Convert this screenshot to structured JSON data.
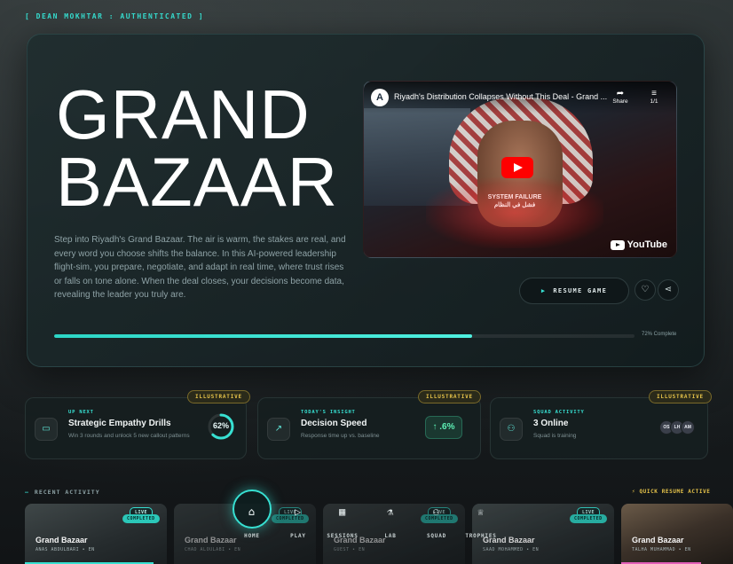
{
  "status": {
    "text": "[ DEAN MOKHTAR : AUTHENTICATED ]"
  },
  "hero": {
    "title_line1": "GRAND",
    "title_line2": "BAZAAR",
    "description": "Step into Riyadh's Grand Bazaar. The air is warm, the stakes are real, and every word you choose shifts the balance. In this AI-powered leadership flight-sim, you prepare, negotiate, and adapt in real time, where trust rises or falls on tone alone. When the deal closes, your decisions become data, revealing the leader you truly are.",
    "video": {
      "title": "Riyadh's Distribution Collapses Without This Deal - Grand ...",
      "share_label": "Share",
      "count_label": "1/1",
      "overlay_text_en": "SYSTEM FAILURE",
      "overlay_text_ar": "فشل في النظام",
      "brand": "YouTube"
    },
    "resume_label": "RESUME GAME",
    "progress": {
      "value": 72,
      "label": "72% Complete"
    }
  },
  "cards": [
    {
      "badge": "ILLUSTRATIVE",
      "kicker": "UP NEXT",
      "title": "Strategic Empathy Drills",
      "subtitle": "Win 3 rounds and unlock 5 new callout patterns",
      "metric": "62%",
      "metric_value": 62,
      "icon": "screen-icon"
    },
    {
      "badge": "ILLUSTRATIVE",
      "kicker": "TODAY'S INSIGHT",
      "title": "Decision Speed",
      "subtitle": "Response time up vs. baseline",
      "metric": "↑ .6%",
      "icon": "trend-icon"
    },
    {
      "badge": "ILLUSTRATIVE",
      "kicker": "SQUAD ACTIVITY",
      "title": "3 Online",
      "subtitle": "Squad is training",
      "avatars": [
        "OS",
        "LH",
        "AM"
      ],
      "icon": "users-icon"
    }
  ],
  "recent": {
    "label": "RECENT ACTIVITY",
    "quick_label": "QUICK RESUME ACTIVE",
    "tiles": [
      {
        "title": "Grand Bazaar",
        "sub": "ANAS ABDULBARI • EN",
        "live": "LIVE",
        "status": "COMPLETED"
      },
      {
        "title": "Grand Bazaar",
        "sub": "CHAD ALOULABI • EN",
        "live": "LIVE",
        "status": "COMPLETED"
      },
      {
        "title": "Grand Bazaar",
        "sub": "GUEST • EN",
        "live": "LIVE",
        "status": "COMPLETED"
      },
      {
        "title": "Grand Bazaar",
        "sub": "SAAD MOHAMMED • EN",
        "live": "LIVE",
        "status": "COMPLETED"
      },
      {
        "title": "Grand Bazaar",
        "sub": "TALHA MUHAMMAD • EN",
        "live": "",
        "status": ""
      }
    ]
  },
  "dock": {
    "items": [
      {
        "label": "HOME",
        "icon": "home-icon"
      },
      {
        "label": "PLAY",
        "icon": "play-icon"
      },
      {
        "label": "SESSIONS",
        "icon": "calendar-icon"
      },
      {
        "label": "LAB",
        "icon": "flask-icon"
      },
      {
        "label": "SQUAD",
        "icon": "users-icon"
      },
      {
        "label": "TROPHIES",
        "icon": "trophy-icon"
      }
    ]
  },
  "colors": {
    "accent": "#37e0d2",
    "badge": "#e6c34a",
    "delta": "#5ef2b6"
  }
}
